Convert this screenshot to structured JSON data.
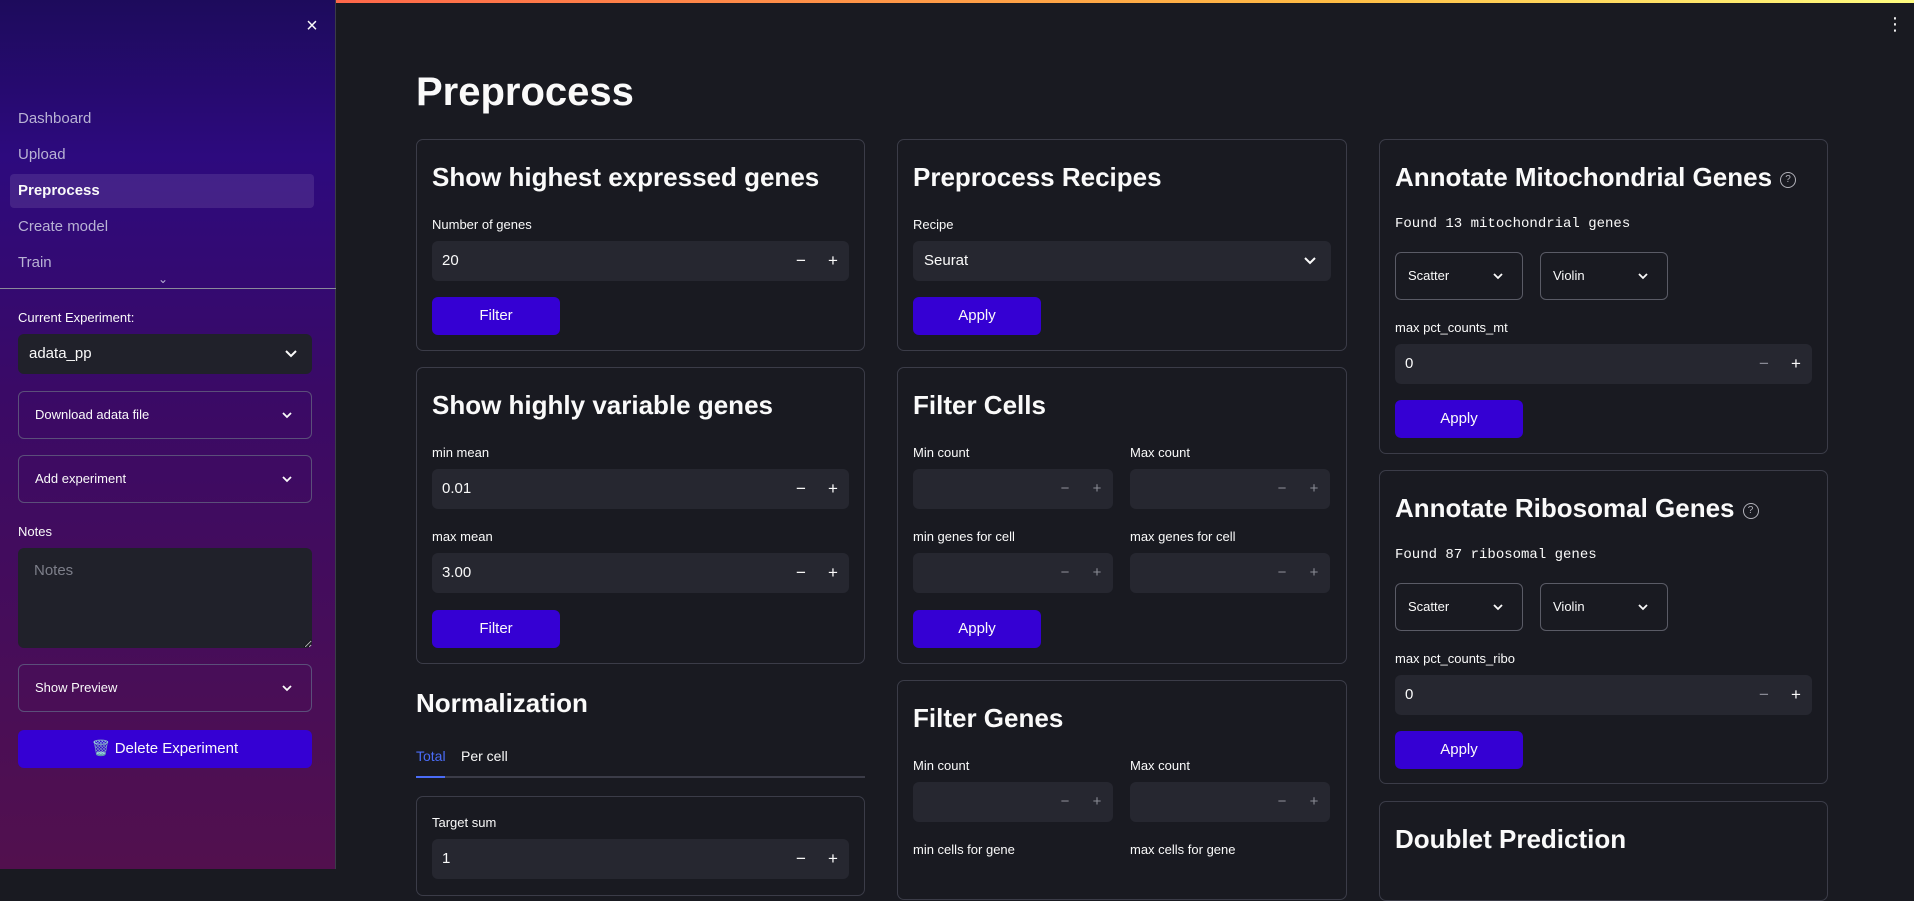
{
  "sidebar": {
    "close_icon": "×",
    "nav_items": [
      {
        "label": "Dashboard"
      },
      {
        "label": "Upload"
      },
      {
        "label": "Preprocess"
      },
      {
        "label": "Create model"
      },
      {
        "label": "Train"
      }
    ],
    "active_nav": "Preprocess",
    "current_experiment_label": "Current Experiment:",
    "current_experiment_value": "adata_pp",
    "download_label": "Download adata file",
    "add_experiment_label": "Add experiment",
    "notes_label": "Notes",
    "notes_placeholder": "Notes",
    "show_preview_label": "Show Preview",
    "delete_label": "🗑️ Delete Experiment"
  },
  "main": {
    "title": "Preprocess",
    "highest_expressed": {
      "title": "Show highest expressed genes",
      "num_genes_label": "Number of genes",
      "num_genes_value": "20",
      "button": "Filter"
    },
    "highly_variable": {
      "title": "Show highly variable genes",
      "min_mean_label": "min mean",
      "min_mean_value": "0.01",
      "max_mean_label": "max mean",
      "max_mean_value": "3.00",
      "button": "Filter"
    },
    "normalization": {
      "title": "Normalization",
      "tabs": [
        "Total",
        "Per cell"
      ],
      "target_sum_label": "Target sum",
      "target_sum_value": "1"
    },
    "recipes": {
      "title": "Preprocess Recipes",
      "recipe_label": "Recipe",
      "recipe_value": "Seurat",
      "button": "Apply"
    },
    "filter_cells": {
      "title": "Filter Cells",
      "min_count_label": "Min count",
      "max_count_label": "Max count",
      "min_genes_label": "min genes for cell",
      "max_genes_label": "max genes for cell",
      "button": "Apply"
    },
    "filter_genes": {
      "title": "Filter Genes",
      "min_count_label": "Min count",
      "max_count_label": "Max count",
      "min_cells_label": "min cells for gene",
      "max_cells_label": "max cells for gene"
    },
    "mito": {
      "title": "Annotate Mitochondrial Genes",
      "found_text": "Found 13 mitochondrial genes",
      "scatter_label": "Scatter",
      "violin_label": "Violin",
      "max_label": "max pct_counts_mt",
      "max_value": "0",
      "button": "Apply"
    },
    "ribo": {
      "title": "Annotate Ribosomal Genes",
      "found_text": "Found 87 ribosomal genes",
      "scatter_label": "Scatter",
      "violin_label": "Violin",
      "max_label": "max pct_counts_ribo",
      "max_value": "0",
      "button": "Apply"
    },
    "doublet": {
      "title": "Doublet Prediction"
    }
  },
  "icons": {
    "minus": "−",
    "plus": "+",
    "chevron": "⌄",
    "help": "?",
    "menu": "⋮"
  },
  "colors": {
    "primary_button": "#3500d3",
    "background": "#191a21",
    "input_bg": "#262730"
  }
}
